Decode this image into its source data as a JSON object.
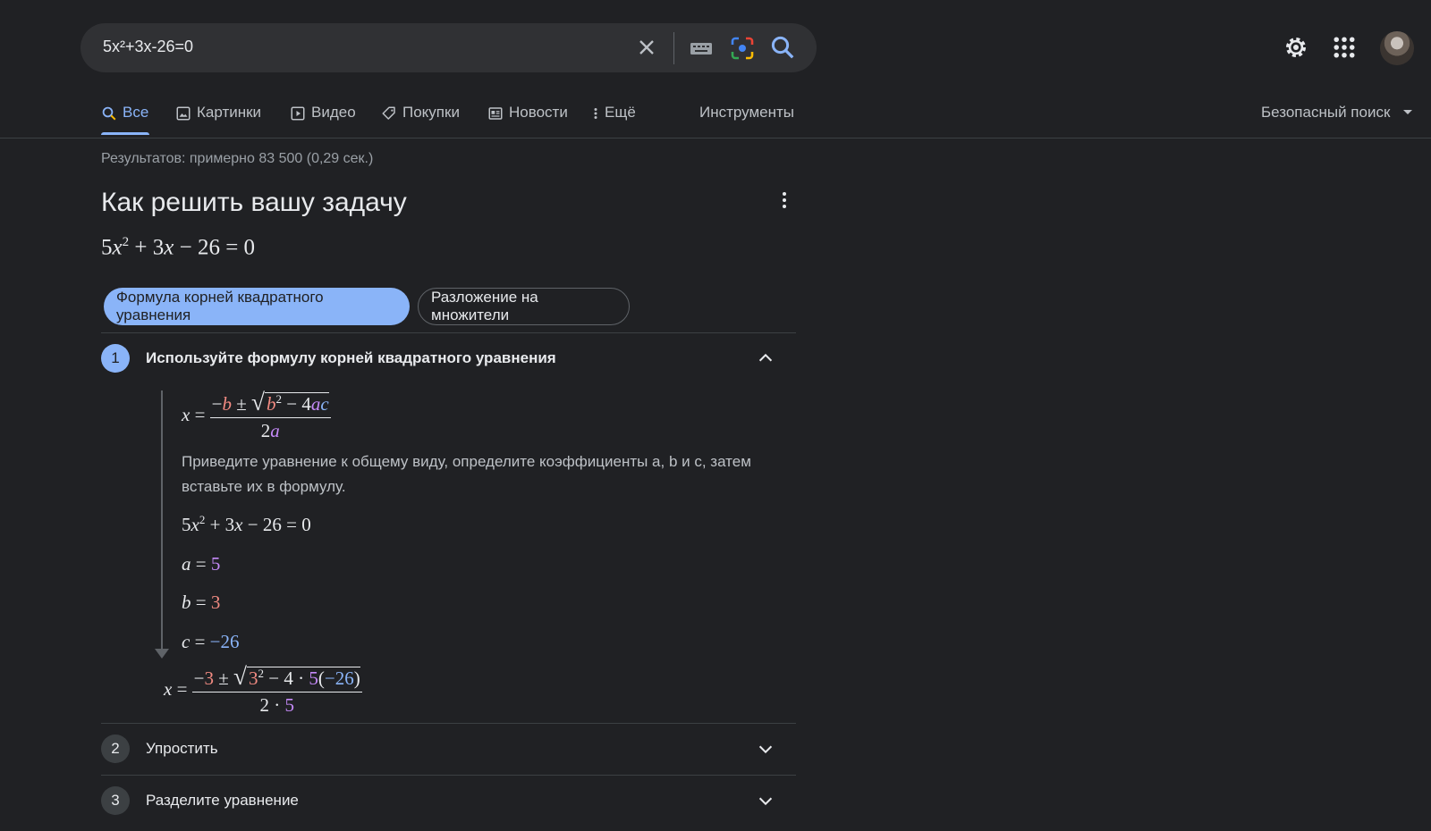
{
  "search": {
    "query": "5x²+3x-26=0"
  },
  "tabs": [
    {
      "label": "Все",
      "icon": "search-icon"
    },
    {
      "label": "Картинки",
      "icon": "image-icon"
    },
    {
      "label": "Видео",
      "icon": "play-icon"
    },
    {
      "label": "Покупки",
      "icon": "tag-icon"
    },
    {
      "label": "Новости",
      "icon": "news-icon"
    },
    {
      "label": "Ещё",
      "icon": "more-vert-icon"
    }
  ],
  "tools_label": "Инструменты",
  "safe_search_label": "Безопасный поиск",
  "stats": "Результатов: примерно 83 500 (0,29 сек.)",
  "solver": {
    "title": "Как решить вашу задачу",
    "equation": {
      "a": "5",
      "x": "x",
      "exp": "2",
      "b": "3",
      "c": "26",
      "rhs": "0"
    },
    "method_chips": [
      "Формула корней квадратного уравнения",
      "Разложение на множители"
    ],
    "steps": [
      {
        "number": "1",
        "title": "Используйте формулу корней квадратного уравнения",
        "expanded": true
      },
      {
        "number": "2",
        "title": "Упростить",
        "expanded": false
      },
      {
        "number": "3",
        "title": "Разделите уравнение",
        "expanded": false
      }
    ],
    "step1": {
      "description": "Приведите уравнение к общему виду, определите коэффициенты a, b и c, затем вставьте их в формулу.",
      "coefficients": {
        "a": "5",
        "b": "3",
        "c": "−26"
      },
      "four": "4",
      "two": "2"
    }
  },
  "colors": {
    "b": "#f28b82",
    "a": "#c58af9",
    "c": "#8ab4f8",
    "accent": "#8ab4f8"
  }
}
